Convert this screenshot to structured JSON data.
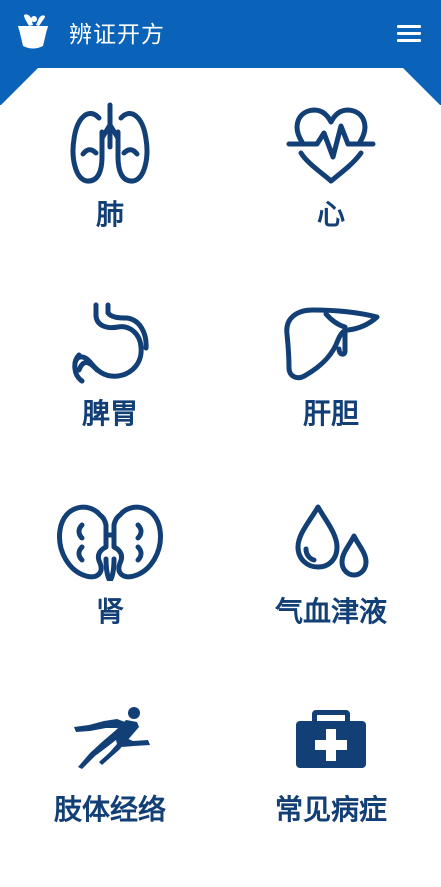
{
  "header": {
    "title": "辨证开方",
    "logo_icon": "mortar-pestle-icon",
    "menu_icon": "hamburger-menu-icon"
  },
  "tiles": [
    {
      "label": "肺",
      "icon": "lungs-icon"
    },
    {
      "label": "心",
      "icon": "heart-pulse-icon"
    },
    {
      "label": "脾胃",
      "icon": "stomach-icon"
    },
    {
      "label": "肝胆",
      "icon": "liver-icon"
    },
    {
      "label": "肾",
      "icon": "kidneys-icon"
    },
    {
      "label": "气血津液",
      "icon": "droplets-icon"
    },
    {
      "label": "肢体经络",
      "icon": "human-body-icon"
    },
    {
      "label": "常见病症",
      "icon": "first-aid-kit-icon"
    }
  ],
  "colors": {
    "header": "#0a63b8",
    "icon": "#123f76",
    "label": "#123f76",
    "background": "#ffffff"
  }
}
